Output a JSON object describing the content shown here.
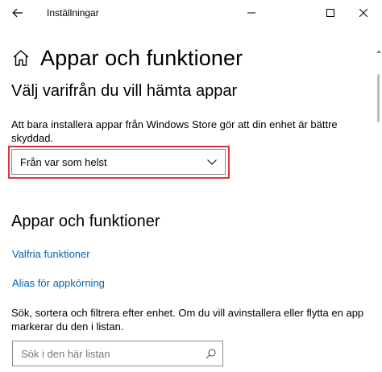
{
  "window": {
    "title": "Inställningar"
  },
  "page": {
    "title": "Appar och funktioner"
  },
  "install_source": {
    "heading": "Välj varifrån du vill hämta appar",
    "description": "Att bara installera appar från Windows Store gör att din enhet är bättre skyddad.",
    "dropdown_value": "Från var som helst"
  },
  "apps_section": {
    "heading": "Appar och funktioner",
    "links": [
      "Valfria funktioner",
      "Alias för appkörning"
    ],
    "description": "Sök, sortera och filtrera efter enhet. Om du vill avinstallera eller flytta en app markerar du den i listan.",
    "search_placeholder": "Sök i den här listan"
  },
  "colors": {
    "link": "#0067b8",
    "highlight": "#d9363e"
  }
}
